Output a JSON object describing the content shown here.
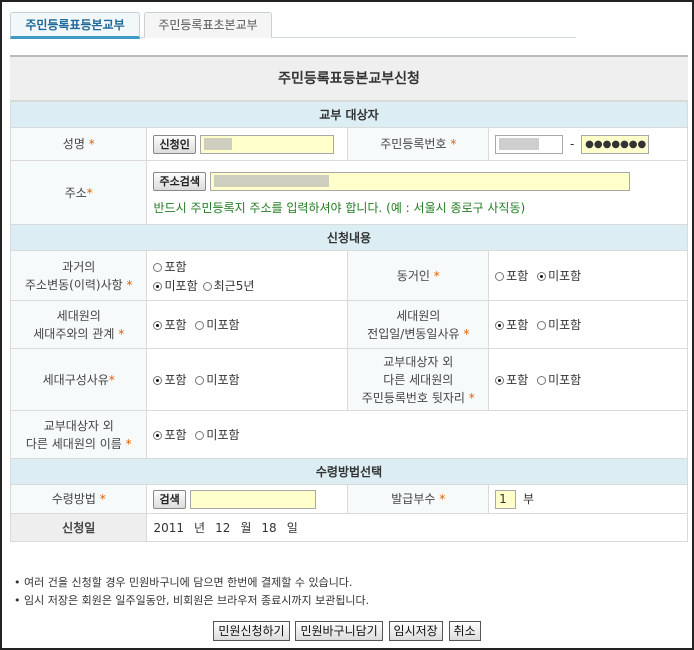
{
  "tabs": [
    {
      "label": "주민등록표등본교부"
    },
    {
      "label": "주민등록표초본교부"
    }
  ],
  "form_title": "주민등록표등본교부신청",
  "sections": {
    "target": "교부 대상자",
    "content": "신청내용",
    "delivery": "수령방법선택"
  },
  "target": {
    "name_label": "성명",
    "applicant_button": "신청인",
    "rrn_label": "주민등록번호",
    "rrn_back": "●●●●●●●",
    "rrn_dash": "-",
    "address_label": "주소",
    "address_search_button": "주소검색",
    "address_note": "반드시 주민등록지 주소를 입력하셔야 합니다. (예 : 서울시 종로구 사직동)"
  },
  "content": {
    "past_address_label_1": "과거의",
    "past_address_label_2": "주소변동(이력)사항",
    "opt_include": "포함",
    "opt_exclude": "미포함",
    "opt_recent5": "최근5년",
    "cohabitant_label": "동거인",
    "relation_label_1": "세대원의",
    "relation_label_2": "세대주와의 관계",
    "movein_label_1": "세대원의",
    "movein_label_2": "전입일/변동일사유",
    "composition_label": "세대구성사유",
    "other_rrn_label_1": "교부대상자 외",
    "other_rrn_label_2": "다른 세대원의",
    "other_rrn_label_3": "주민등록번호 뒷자리",
    "other_name_label_1": "교부대상자 외",
    "other_name_label_2": "다른 세대원의 이름",
    "req_mark": "*"
  },
  "delivery": {
    "method_label": "수령방법",
    "search_button": "검색",
    "copies_label": "발급부수",
    "copies_value": "1",
    "copies_unit": "부",
    "date_label": "신청일",
    "date_year": "2011",
    "date_year_unit": "년",
    "date_month": "12",
    "date_month_unit": "월",
    "date_day": "18",
    "date_day_unit": "일"
  },
  "notes": [
    "• 여러 건을 신청할 경우 민원바구니에 담으면 한번에 결제할 수 있습니다.",
    "• 임시 저장은 회원은 일주일동안, 비회원은 브라우저 종료시까지 보관됩니다."
  ],
  "actions": {
    "submit": "민원신청하기",
    "basket": "민원바구니담기",
    "temp_save": "임시저장",
    "cancel": "취소"
  }
}
